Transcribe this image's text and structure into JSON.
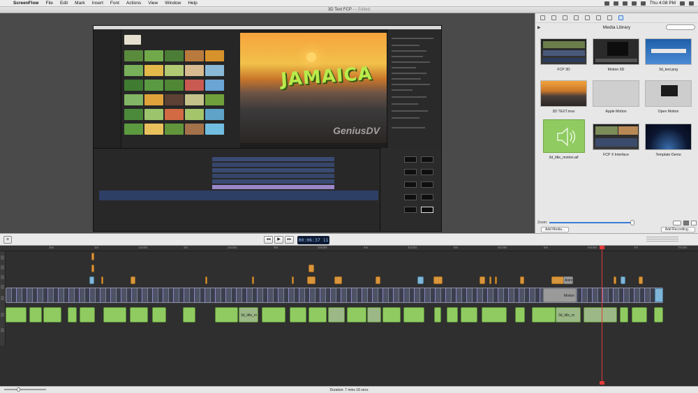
{
  "menubar": {
    "app_name": "ScreenFlow",
    "items": [
      "File",
      "Edit",
      "Mark",
      "Insert",
      "Font",
      "Actions",
      "View",
      "Window",
      "Help"
    ],
    "clock": "Thu 4:08 PM"
  },
  "window": {
    "title": "3D Text FCP",
    "edited": "— Edited"
  },
  "recording": {
    "overlay_text": "JAMAICA",
    "watermark": "GeniusDV"
  },
  "media_library": {
    "title": "Media Library",
    "search_placeholder": "",
    "items": [
      {
        "label": "FCP 3D"
      },
      {
        "label": "Motion 3D"
      },
      {
        "label": "3d_text.png"
      },
      {
        "label": "3D TEXT.mov"
      },
      {
        "label": "Apple Motion"
      },
      {
        "label": "Open Motion"
      },
      {
        "label": "3d_title_motion.aif"
      },
      {
        "label": "FCP X Interface"
      },
      {
        "label": "Template Demo"
      }
    ],
    "zoom_label": "Zoom:",
    "add_media": "Add Media...",
    "add_recording": "Add Recording..."
  },
  "transport": {
    "rewind": "◂◂",
    "play": "▶",
    "forward": "▸▸",
    "timecode": "00:06:37 11"
  },
  "timeline": {
    "ruler": [
      "30s",
      "1m",
      "1m30s",
      "2m",
      "2m30s",
      "3m",
      "3m30s",
      "4m",
      "4m30s",
      "5m",
      "5m30s",
      "6m",
      "6m30s",
      "7m",
      "7m30s"
    ],
    "clip_label_motion": "Motion",
    "clip_label_audio": "3d_title_m",
    "clip_label_anim": "Anim"
  },
  "status": {
    "duration": "Duration: 7 mins 18 secs"
  },
  "colors": {
    "accent": "#3a7bd5",
    "playhead": "#e23a3a",
    "audio_clip": "#8fcb61",
    "callout_clip": "#d8953b"
  }
}
